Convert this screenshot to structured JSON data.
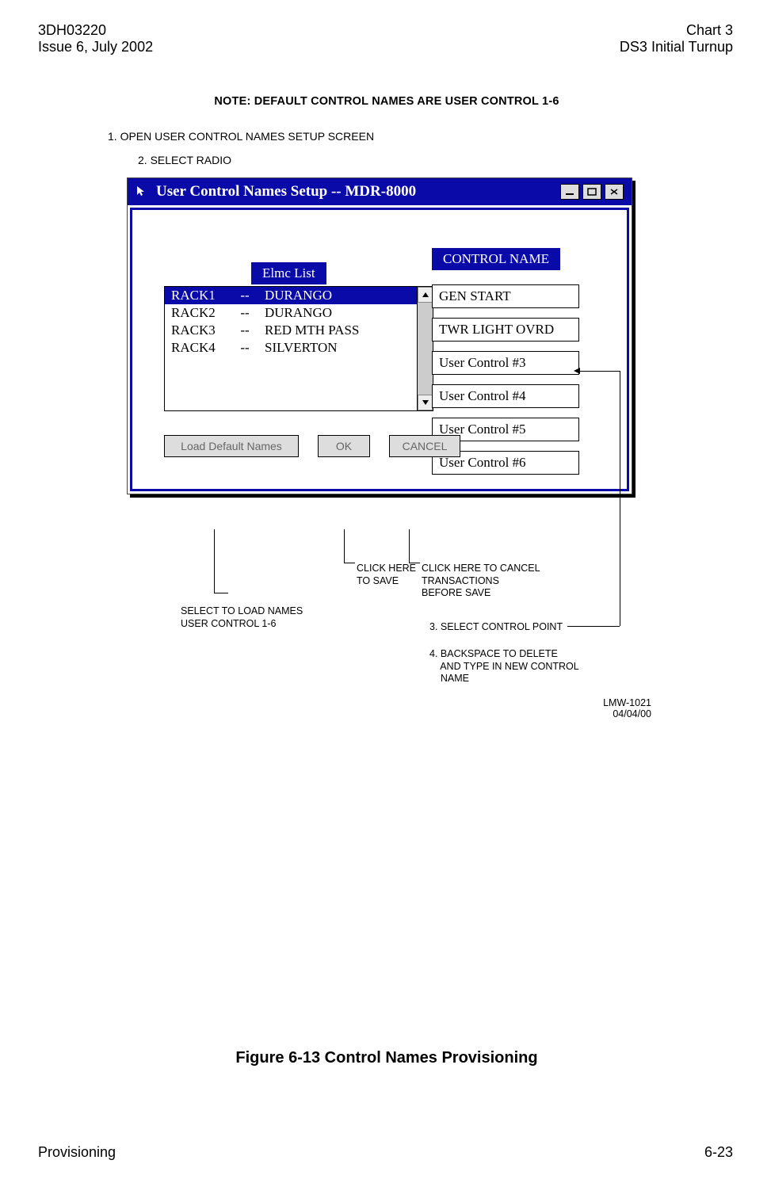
{
  "header": {
    "left1": "3DH03220",
    "left2": "Issue 6, July 2002",
    "right1": "Chart 3",
    "right2": "DS3 Initial Turnup"
  },
  "note": "NOTE: DEFAULT CONTROL NAMES ARE USER CONTROL 1-6",
  "steps": {
    "s1": "1. OPEN USER CONTROL NAMES SETUP SCREEN",
    "s2": "2. SELECT RADIO"
  },
  "window": {
    "title": "User Control Names Setup  --  MDR-8000",
    "elmc_label": "Elmc List",
    "cn_label": "CONTROL NAME",
    "rows": [
      {
        "c1": "RACK1",
        "c2": "--",
        "c3": "DURANGO",
        "sel": true
      },
      {
        "c1": "RACK2",
        "c2": "--",
        "c3": "DURANGO",
        "sel": false
      },
      {
        "c1": "RACK3",
        "c2": "--",
        "c3": "RED MTH PASS",
        "sel": false
      },
      {
        "c1": "RACK4",
        "c2": "--",
        "c3": "SILVERTON",
        "sel": false
      }
    ],
    "fields": [
      "GEN START",
      "TWR LIGHT OVRD",
      "User Control #3",
      "User Control #4",
      "User Control #5",
      "User Control #6"
    ],
    "btn_load": "Load Default Names",
    "btn_ok": "OK",
    "btn_cancel": "CANCEL"
  },
  "annotations": {
    "save": "CLICK HERE\nTO SAVE",
    "cancel": "CLICK HERE TO CANCEL\nTRANSACTIONS\nBEFORE SAVE",
    "load": "SELECT TO LOAD NAMES\nUSER CONTROL 1-6",
    "s3": "3. SELECT CONTROL POINT",
    "s4": "4. BACKSPACE TO DELETE\n    AND TYPE IN NEW CONTROL\n    NAME",
    "lmw1": "LMW-1021",
    "lmw2": "04/04/00"
  },
  "figcaption": "Figure 6-13  Control Names Provisioning",
  "footer": {
    "left": "Provisioning",
    "right": "6-23"
  }
}
